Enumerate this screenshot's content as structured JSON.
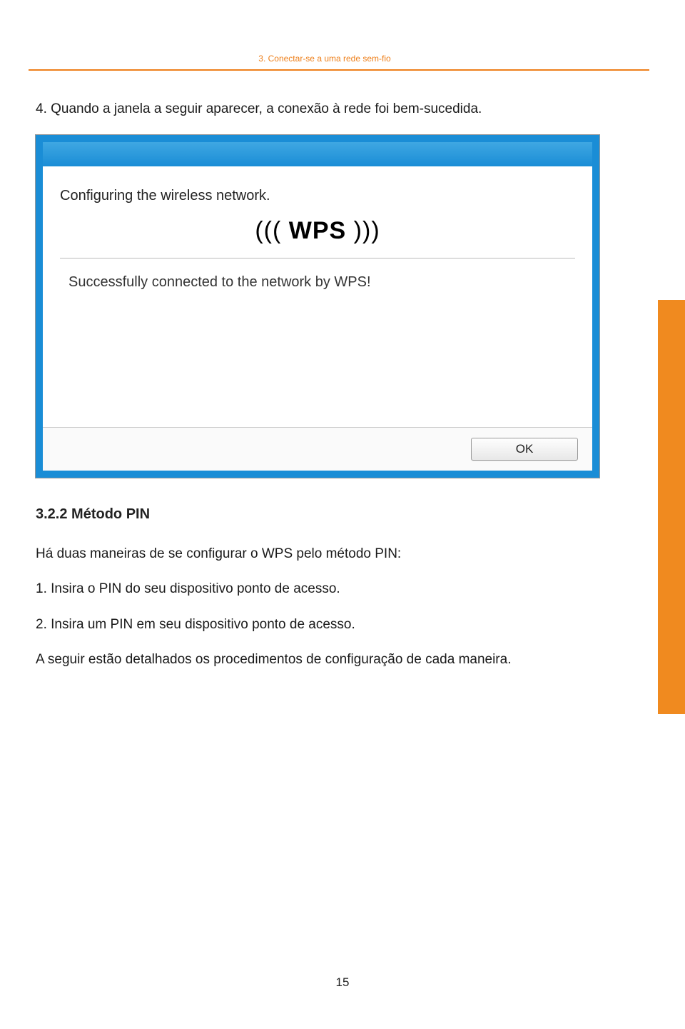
{
  "header": {
    "breadcrumb": "3. Conectar-se a uma rede sem-fio"
  },
  "content": {
    "step4": "4. Quando a janela a seguir aparecer, a conexão à rede foi bem-sucedida.",
    "section_heading": "3.2.2 Método PIN",
    "intro": "Há duas maneiras de se configurar o WPS pelo método PIN:",
    "item1": "1. Insira o PIN do seu dispositivo ponto de acesso.",
    "item2": "2. Insira um PIN em seu dispositivo ponto de acesso.",
    "closing": "A seguir estão detalhados os procedimentos de configuração de cada maneira."
  },
  "dialog": {
    "configuring": "Configuring the wireless network.",
    "wps_logo": "((( WPS )))",
    "success": "Successfully connected to the network by WPS!",
    "ok_label": "OK"
  },
  "page_number": "15"
}
